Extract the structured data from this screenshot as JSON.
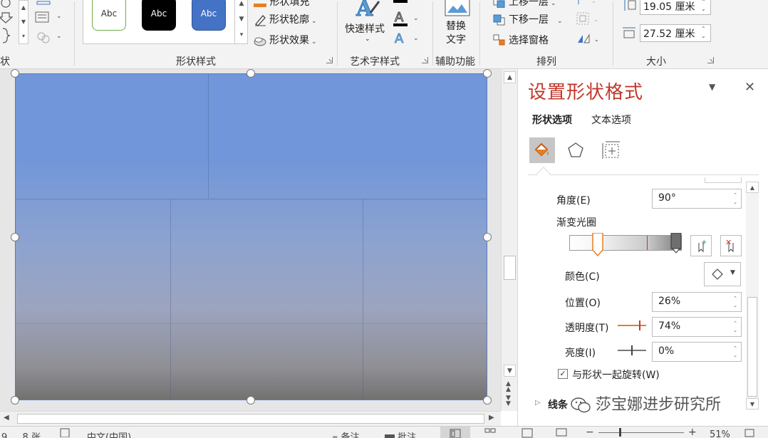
{
  "ribbon": {
    "partial_group_label": "状",
    "shape_styles": {
      "group_label": "形状样式",
      "presets": [
        {
          "label": "Abc",
          "bg": "#ffffff",
          "border": "#70ad47",
          "text": "#333333"
        },
        {
          "label": "Abc",
          "bg": "#000000",
          "border": "#000000",
          "text": "#ffffff"
        },
        {
          "label": "Abc",
          "bg": "#4472c4",
          "border": "#2f5597",
          "text": "#ffffff"
        }
      ],
      "fill_label": "形状填充",
      "outline_label": "形状轮廓",
      "effects_label": "形状效果"
    },
    "wordart": {
      "group_label": "艺术字样式",
      "quick_styles_label": "快速样式"
    },
    "accessibility": {
      "group_label": "辅助功能",
      "alt_text_line1": "替换",
      "alt_text_line2": "文字"
    },
    "arrange": {
      "group_label": "排列",
      "bring_forward_label": "上移一层",
      "send_backward_label": "下移一层",
      "selection_pane_label": "选择窗格"
    },
    "size": {
      "group_label": "大小",
      "height_value": "19.05 厘米",
      "width_value": "27.52 厘米"
    }
  },
  "format_pane": {
    "title": "设置形状格式",
    "tabs": [
      {
        "label": "形状选项",
        "active": true
      },
      {
        "label": "文本选项",
        "active": false
      }
    ],
    "angle_label": "角度(E)",
    "angle_value": "90°",
    "gradient_stops_label": "渐变光圈",
    "color_label": "颜色(C)",
    "position_label": "位置(O)",
    "position_value": "26%",
    "transparency_label": "透明度(T)",
    "transparency_value": "74%",
    "brightness_label": "亮度(I)",
    "brightness_value": "0%",
    "rotate_with_shape_label": "与形状一起旋转(W)",
    "rotate_with_shape_checked": true,
    "line_section_label": "线条"
  },
  "watermark": {
    "text": "莎宝娜进步研究所"
  },
  "statusbar": {
    "slide_info": "9 ， 8 张",
    "language": "中文(中国)",
    "notes_label": "备注",
    "comments_label": "批注",
    "zoom": "51%"
  },
  "colors": {
    "accent_red": "#c0392b",
    "gradient_top": "#7196d9",
    "gradient_bottom": "#727272",
    "selected_stop": "#e67e22"
  }
}
